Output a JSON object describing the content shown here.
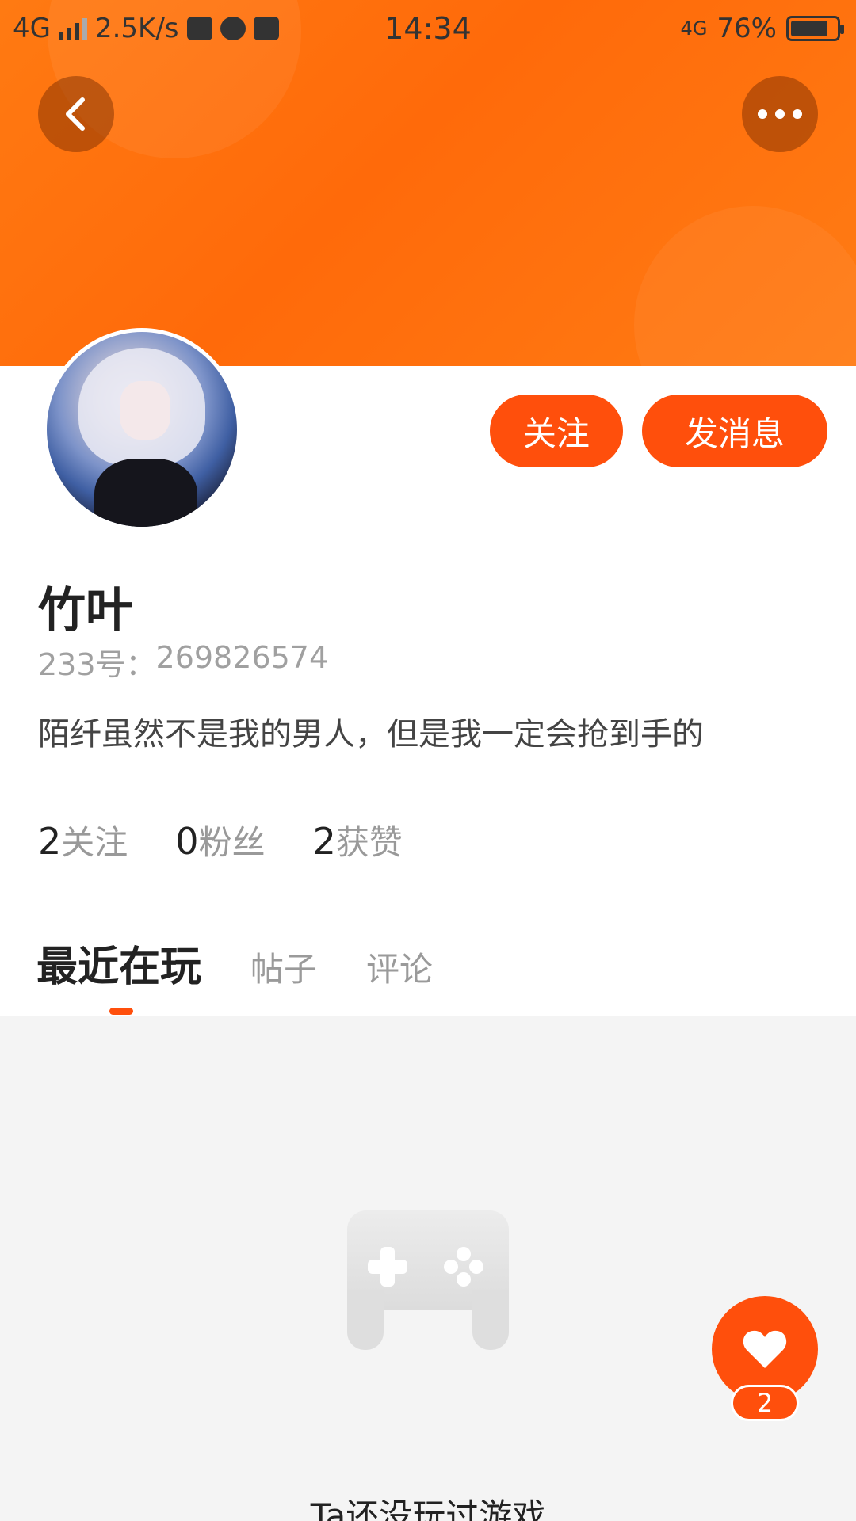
{
  "status_bar": {
    "network": "4G",
    "speed": "2.5K/s",
    "time": "14:34",
    "network_right": "4G",
    "battery": "76%"
  },
  "profile": {
    "username": "竹叶",
    "id_label": "233号：",
    "id_value": "269826574",
    "bio": "陌纤虽然不是我的男人，但是我一定会抢到手的",
    "follow_label": "关注",
    "message_label": "发消息"
  },
  "stats": [
    {
      "value": "2",
      "label": "关注"
    },
    {
      "value": "0",
      "label": "粉丝"
    },
    {
      "value": "2",
      "label": "获赞"
    }
  ],
  "tabs": [
    {
      "label": "最近在玩",
      "active": true
    },
    {
      "label": "帖子",
      "active": false
    },
    {
      "label": "评论",
      "active": false
    }
  ],
  "empty_state": {
    "text": "Ta还没玩过游戏"
  },
  "like": {
    "count": "2"
  },
  "colors": {
    "accent": "#ff4f0c",
    "header": "#ff7a12"
  }
}
